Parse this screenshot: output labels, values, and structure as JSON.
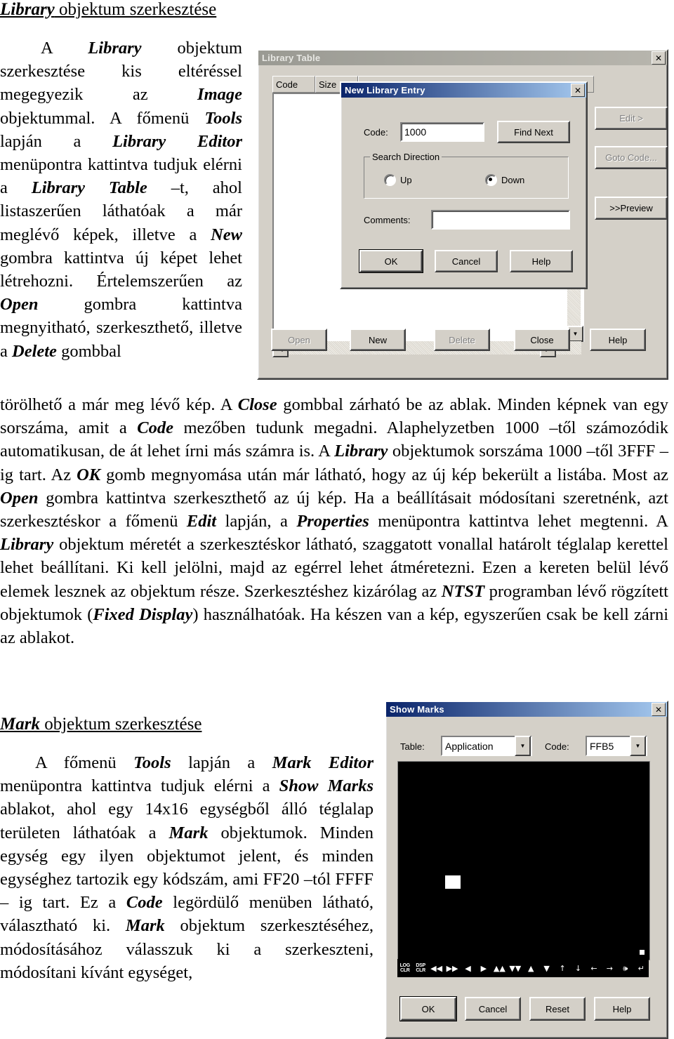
{
  "document": {
    "heading1_bold": "Library",
    "heading1_rest": " objektum szerkesztése",
    "column_paragraph_1": "A Library objektum szerkesztése kis eltéréssel megegyezik az Image objektummal. A főmenü Tools lapján a Library Editor menüpontra kattintva tudjuk elérni a Library Table –t, ahol listaszerűen láthatóak a már meglévő képek, illetve a New gombra kattintva új képet lehet létrehozni. Értelemszerűen az Open gombra kattintva megnyitható, szerkeszthető, illetve a Delete gombbal",
    "full_paragraph": "törölhető a már meg lévő kép. A Close gombbal zárható be az ablak. Minden képnek van egy sorszáma, amit a Code mezőben tudunk megadni. Alaphelyzetben 1000 –től számozódik automatikusan, de át lehet írni más számra is. A Library objektumok sorszáma 1000 –től 3FFF –ig tart. Az OK gomb megnyomása után már látható, hogy az új kép bekerült a listába. Most az Open gombra kattintva szerkeszthető az új kép. Ha a beállításait módosítani szeretnénk, azt szerkesztéskor a főmenü Edit lapján, a Properties menüpontra kattintva lehet megtenni. A Library objektum méretét a szerkesztéskor látható, szaggatott vonallal határolt téglalap kerettel lehet beállítani. Ki kell jelölni, majd az egérrel lehet átméretezni. Ezen a kereten belül lévő elemek lesznek az objektum része. Szerkesztéshez kizárólag az NTST programban lévő rögzített objektumok (Fixed Display) használhatóak. Ha készen van a kép, egyszerűen csak be kell zárni az ablakot.",
    "heading2_bold": "Mark",
    "heading2_rest": " objektum szerkesztése",
    "column_paragraph_2": "A főmenü Tools lapján a Mark Editor menüpontra kattintva tudjuk elérni a Show Marks ablakot, ahol egy 14x16 egységből álló téglalap területen láthatóak a Mark objektumok. Minden egység egy ilyen objektumot jelent, és minden egységhez tartozik egy kódszám, ami FF20 –tól FFFF – ig tart. Ez a Code legördülő menüben látható, választható ki. Mark objektum szerkesztéséhez, módosításához válasszuk ki a szerkeszteni, módosítani kívánt egységet,"
  },
  "library_table_window": {
    "title": "Library Table",
    "close_icon": "close-icon",
    "columns": [
      "Code",
      "Size"
    ],
    "side_buttons": [
      {
        "label": "Edit >",
        "enabled": false
      },
      {
        "label": "Goto Code...",
        "enabled": false
      },
      {
        "label": ">>Preview",
        "enabled": true
      }
    ],
    "bottom_buttons": [
      {
        "label": "Open",
        "enabled": false
      },
      {
        "label": "New",
        "enabled": true
      },
      {
        "label": "Delete",
        "enabled": false
      },
      {
        "label": "Close",
        "enabled": true
      },
      {
        "label": "Help",
        "enabled": true
      }
    ],
    "scroll_left_icon": "triangle-left-icon",
    "scroll_right_icon": "triangle-right-icon",
    "scroll_down_icon": "triangle-down-icon"
  },
  "new_library_entry_dialog": {
    "title": "New Library Entry",
    "close_icon": "close-icon",
    "code_label": "Code:",
    "code_value": "1000",
    "find_next_label": "Find Next",
    "search_direction_label": "Search Direction",
    "radio_up_label": "Up",
    "radio_down_label": "Down",
    "selected_direction": "Down",
    "comments_label": "Comments:",
    "comments_value": "",
    "buttons": [
      {
        "label": "OK",
        "default": true
      },
      {
        "label": "Cancel",
        "default": false
      },
      {
        "label": "Help",
        "default": false
      }
    ]
  },
  "show_marks_window": {
    "title": "Show Marks",
    "close_icon": "close-icon",
    "table_label": "Table:",
    "table_value": "Application",
    "code_label": "Code:",
    "code_value": "FFB5",
    "grid": {
      "columns": 16,
      "rows": 14,
      "selected_cell": {
        "row": 9,
        "col": 4
      },
      "marker_cell": {
        "row": 14,
        "col": 16
      }
    },
    "tool_row": [
      {
        "name": "log-clr-button",
        "kind": "text",
        "line1": "LOG",
        "line2": "CLR"
      },
      {
        "name": "dsp-clr-button",
        "kind": "text",
        "line1": "DSP",
        "line2": "CLR"
      },
      {
        "name": "rewind-icon",
        "kind": "glyph",
        "glyph": "◀◀"
      },
      {
        "name": "fast-forward-icon",
        "kind": "glyph",
        "glyph": "▶▶"
      },
      {
        "name": "prev-icon",
        "kind": "glyph",
        "glyph": "◀"
      },
      {
        "name": "next-icon",
        "kind": "glyph",
        "glyph": "▶"
      },
      {
        "name": "page-up-icon",
        "kind": "glyph",
        "glyph": "▲▲"
      },
      {
        "name": "page-down-icon",
        "kind": "glyph",
        "glyph": "▼▼"
      },
      {
        "name": "up-triangle-icon",
        "kind": "glyph",
        "glyph": "▲"
      },
      {
        "name": "down-triangle-icon",
        "kind": "glyph",
        "glyph": "▼"
      },
      {
        "name": "arrow-up-icon",
        "kind": "glyph",
        "glyph": "↑"
      },
      {
        "name": "arrow-down-icon",
        "kind": "glyph",
        "glyph": "↓"
      },
      {
        "name": "arrow-left-icon",
        "kind": "glyph",
        "glyph": "←"
      },
      {
        "name": "arrow-right-icon",
        "kind": "glyph",
        "glyph": "→"
      },
      {
        "name": "sound-icon",
        "kind": "glyph",
        "glyph": "🕪"
      },
      {
        "name": "enter-icon",
        "kind": "glyph",
        "glyph": "↵"
      }
    ],
    "buttons": [
      {
        "label": "OK",
        "default": true
      },
      {
        "label": "Cancel",
        "default": false
      },
      {
        "label": "Reset",
        "default": false
      },
      {
        "label": "Help",
        "default": false
      }
    ]
  },
  "colors": {
    "window_face": "#d4d0c8",
    "active_title": "#0a246a",
    "inactive_title": "#9a9a93",
    "grid_background": "#000000",
    "grid_mark": "#ffffff"
  }
}
